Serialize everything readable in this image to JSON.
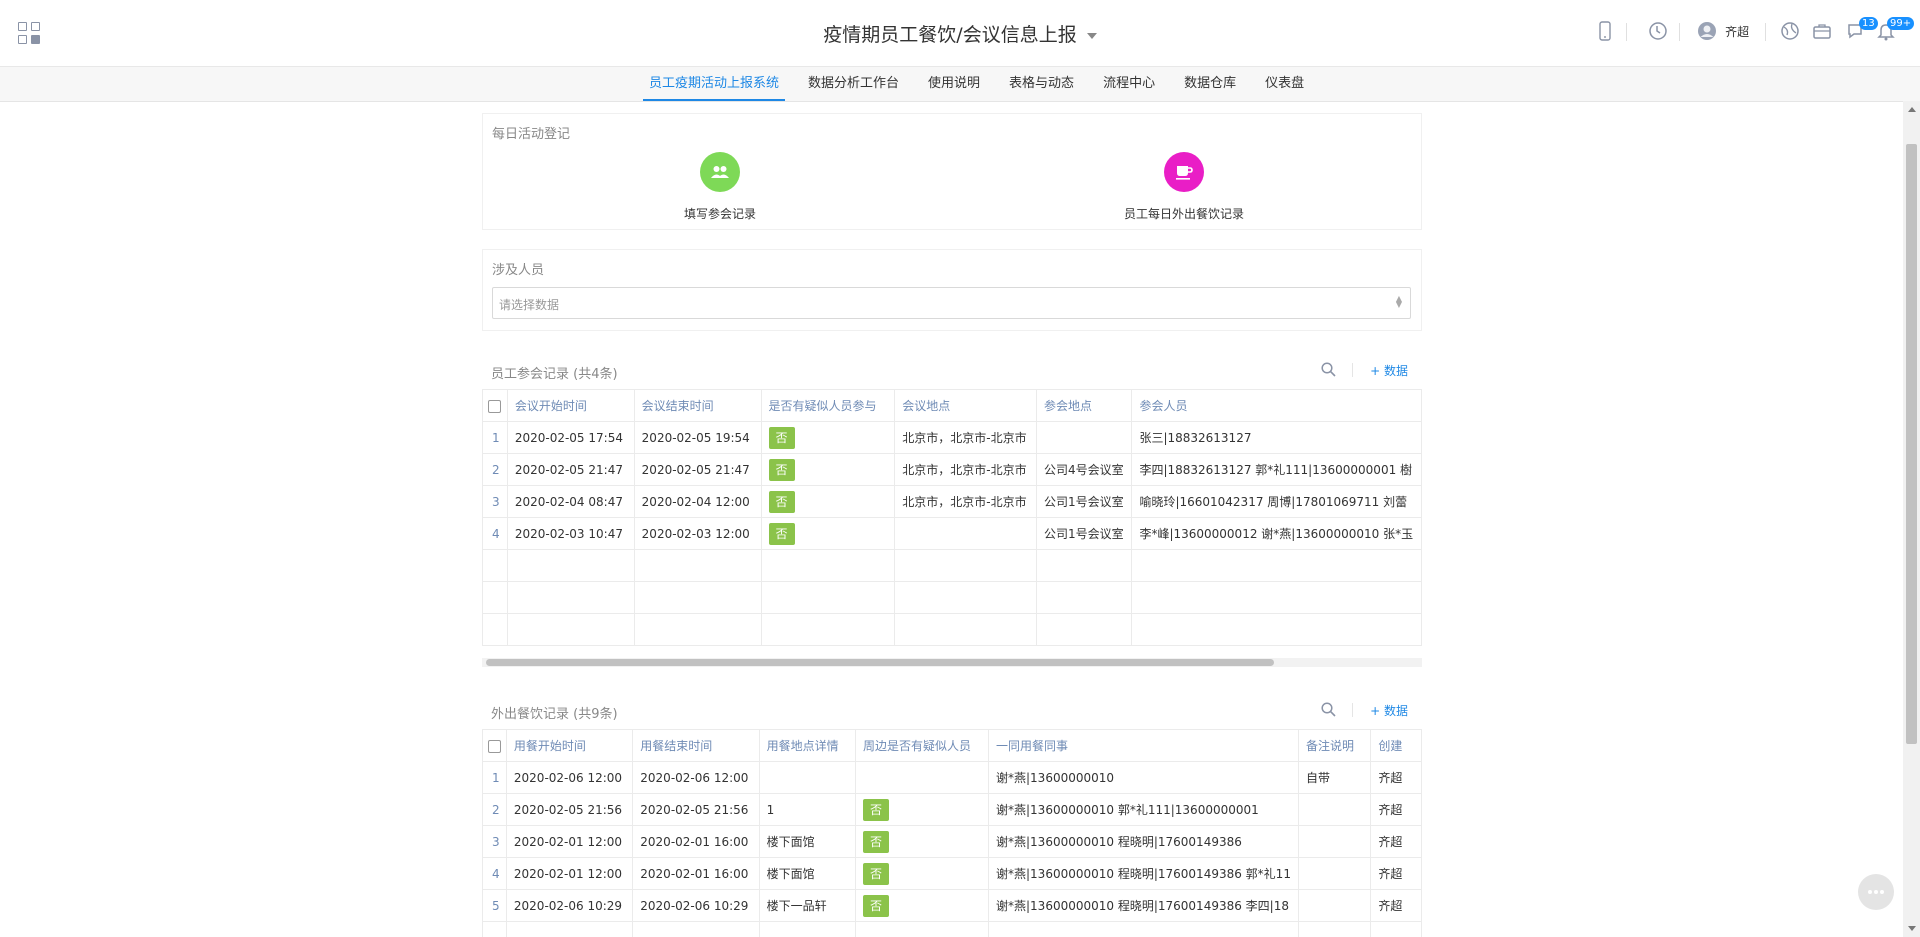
{
  "header": {
    "title": "疫情期员工餐饮/会议信息上报",
    "user_name": "齐超",
    "notification_badge": "13",
    "bell_badge": "99+"
  },
  "nav": {
    "items": [
      {
        "label": "员工疫期活动上报系统"
      },
      {
        "label": "数据分析工作台"
      },
      {
        "label": "使用说明"
      },
      {
        "label": "表格与动态"
      },
      {
        "label": "流程中心"
      },
      {
        "label": "数据仓库"
      },
      {
        "label": "仪表盘"
      }
    ],
    "active_index": 0,
    "active_color": "#1e88e5"
  },
  "daily": {
    "title": "每日活动登记",
    "items": [
      {
        "label": "填写参会记录",
        "icon": "group-icon",
        "color": "#7ed957"
      },
      {
        "label": "员工每日外出餐饮记录",
        "icon": "coffee-cup-icon",
        "color": "#e91ec6"
      }
    ]
  },
  "involved": {
    "title": "涉及人员",
    "placeholder": "请选择数据"
  },
  "meeting_table": {
    "title": "员工参会记录 (共4条)",
    "add_label": "+ 数据",
    "columns": [
      "会议开始时间",
      "会议结束时间",
      "是否有疑似人员参与",
      "会议地点",
      "参会地点",
      "参会人员"
    ],
    "rows": [
      {
        "idx": "1",
        "start": "2020-02-05 17:54",
        "end": "2020-02-05 19:54",
        "suspect": "否",
        "location": "北京市，北京市-北京市",
        "venue": "",
        "people": "张三|18832613127"
      },
      {
        "idx": "2",
        "start": "2020-02-05 21:47",
        "end": "2020-02-05 21:47",
        "suspect": "否",
        "location": "北京市，北京市-北京市",
        "venue": "公司4号会议室",
        "people": "李四|18832613127 郭*礼111|13600000001 樹"
      },
      {
        "idx": "3",
        "start": "2020-02-04 08:47",
        "end": "2020-02-04 12:00",
        "suspect": "否",
        "location": "北京市，北京市-北京市",
        "venue": "公司1号会议室",
        "people": "喻晓玲|16601042317 周博|17801069711 刘蕾"
      },
      {
        "idx": "4",
        "start": "2020-02-03 10:47",
        "end": "2020-02-03 12:00",
        "suspect": "否",
        "location": "",
        "venue": "公司1号会议室",
        "people": "李*峰|13600000012 谢*燕|13600000010 张*玉"
      }
    ]
  },
  "dining_table": {
    "title": "外出餐饮记录 (共9条)",
    "add_label": "+ 数据",
    "columns": [
      "用餐开始时间",
      "用餐结束时间",
      "用餐地点详情",
      "周边是否有疑似人员",
      "一同用餐同事",
      "备注说明",
      "创建"
    ],
    "rows": [
      {
        "idx": "1",
        "start": "2020-02-06 12:00",
        "end": "2020-02-06 12:00",
        "place": "",
        "suspect": "",
        "colleagues": "谢*燕|13600000010",
        "note": "自带",
        "creator": "齐超"
      },
      {
        "idx": "2",
        "start": "2020-02-05 21:56",
        "end": "2020-02-05 21:56",
        "place": "1",
        "suspect": "否",
        "colleagues": "谢*燕|13600000010 郭*礼111|13600000001",
        "note": "",
        "creator": "齐超"
      },
      {
        "idx": "3",
        "start": "2020-02-01 12:00",
        "end": "2020-02-01 16:00",
        "place": "楼下面馆",
        "suspect": "否",
        "colleagues": "谢*燕|13600000010 程晓明|17600149386",
        "note": "",
        "creator": "齐超"
      },
      {
        "idx": "4",
        "start": "2020-02-01 12:00",
        "end": "2020-02-01 16:00",
        "place": "楼下面馆",
        "suspect": "否",
        "colleagues": "谢*燕|13600000010 程晓明|17600149386 郭*礼11",
        "note": "",
        "creator": "齐超"
      },
      {
        "idx": "5",
        "start": "2020-02-06 10:29",
        "end": "2020-02-06 10:29",
        "place": "楼下一品轩",
        "suspect": "否",
        "colleagues": "谢*燕|13600000010 程晓明|17600149386 李四|18",
        "note": "",
        "creator": "齐超"
      }
    ]
  },
  "colors": {
    "tag_green": "#8bc34a",
    "header_blue": "#6f8bb5"
  }
}
